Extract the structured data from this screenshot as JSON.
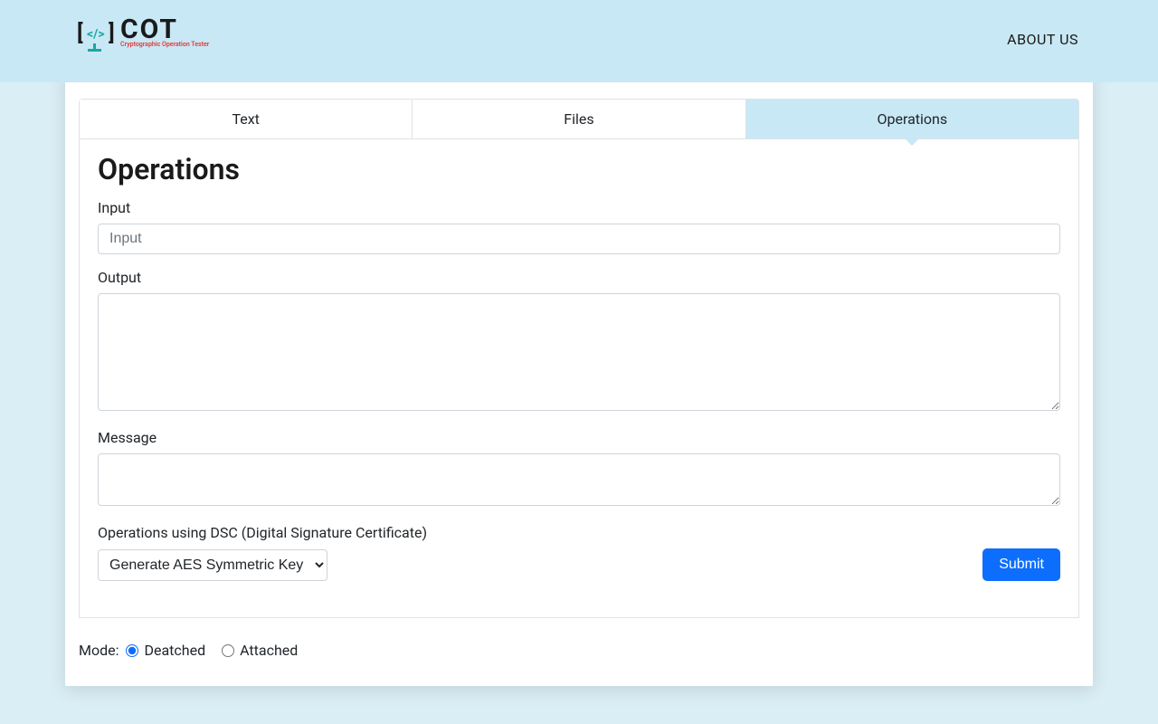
{
  "header": {
    "logo_main": "COT",
    "logo_sub": "Cryptographic Operation Tester",
    "nav_about": "ABOUT US"
  },
  "tabs": [
    {
      "label": "Text",
      "active": false
    },
    {
      "label": "Files",
      "active": false
    },
    {
      "label": "Operations",
      "active": true
    }
  ],
  "content": {
    "heading": "Operations",
    "input_label": "Input",
    "input_placeholder": "Input",
    "output_label": "Output",
    "message_label": "Message",
    "operations_label": "Operations using DSC (Digital Signature Certificate)",
    "select_value": "Generate AES Symmetric Key",
    "submit_label": "Submit"
  },
  "mode": {
    "label": "Mode:",
    "option1": "Deatched",
    "option2": "Attached",
    "selected": "Deatched"
  }
}
